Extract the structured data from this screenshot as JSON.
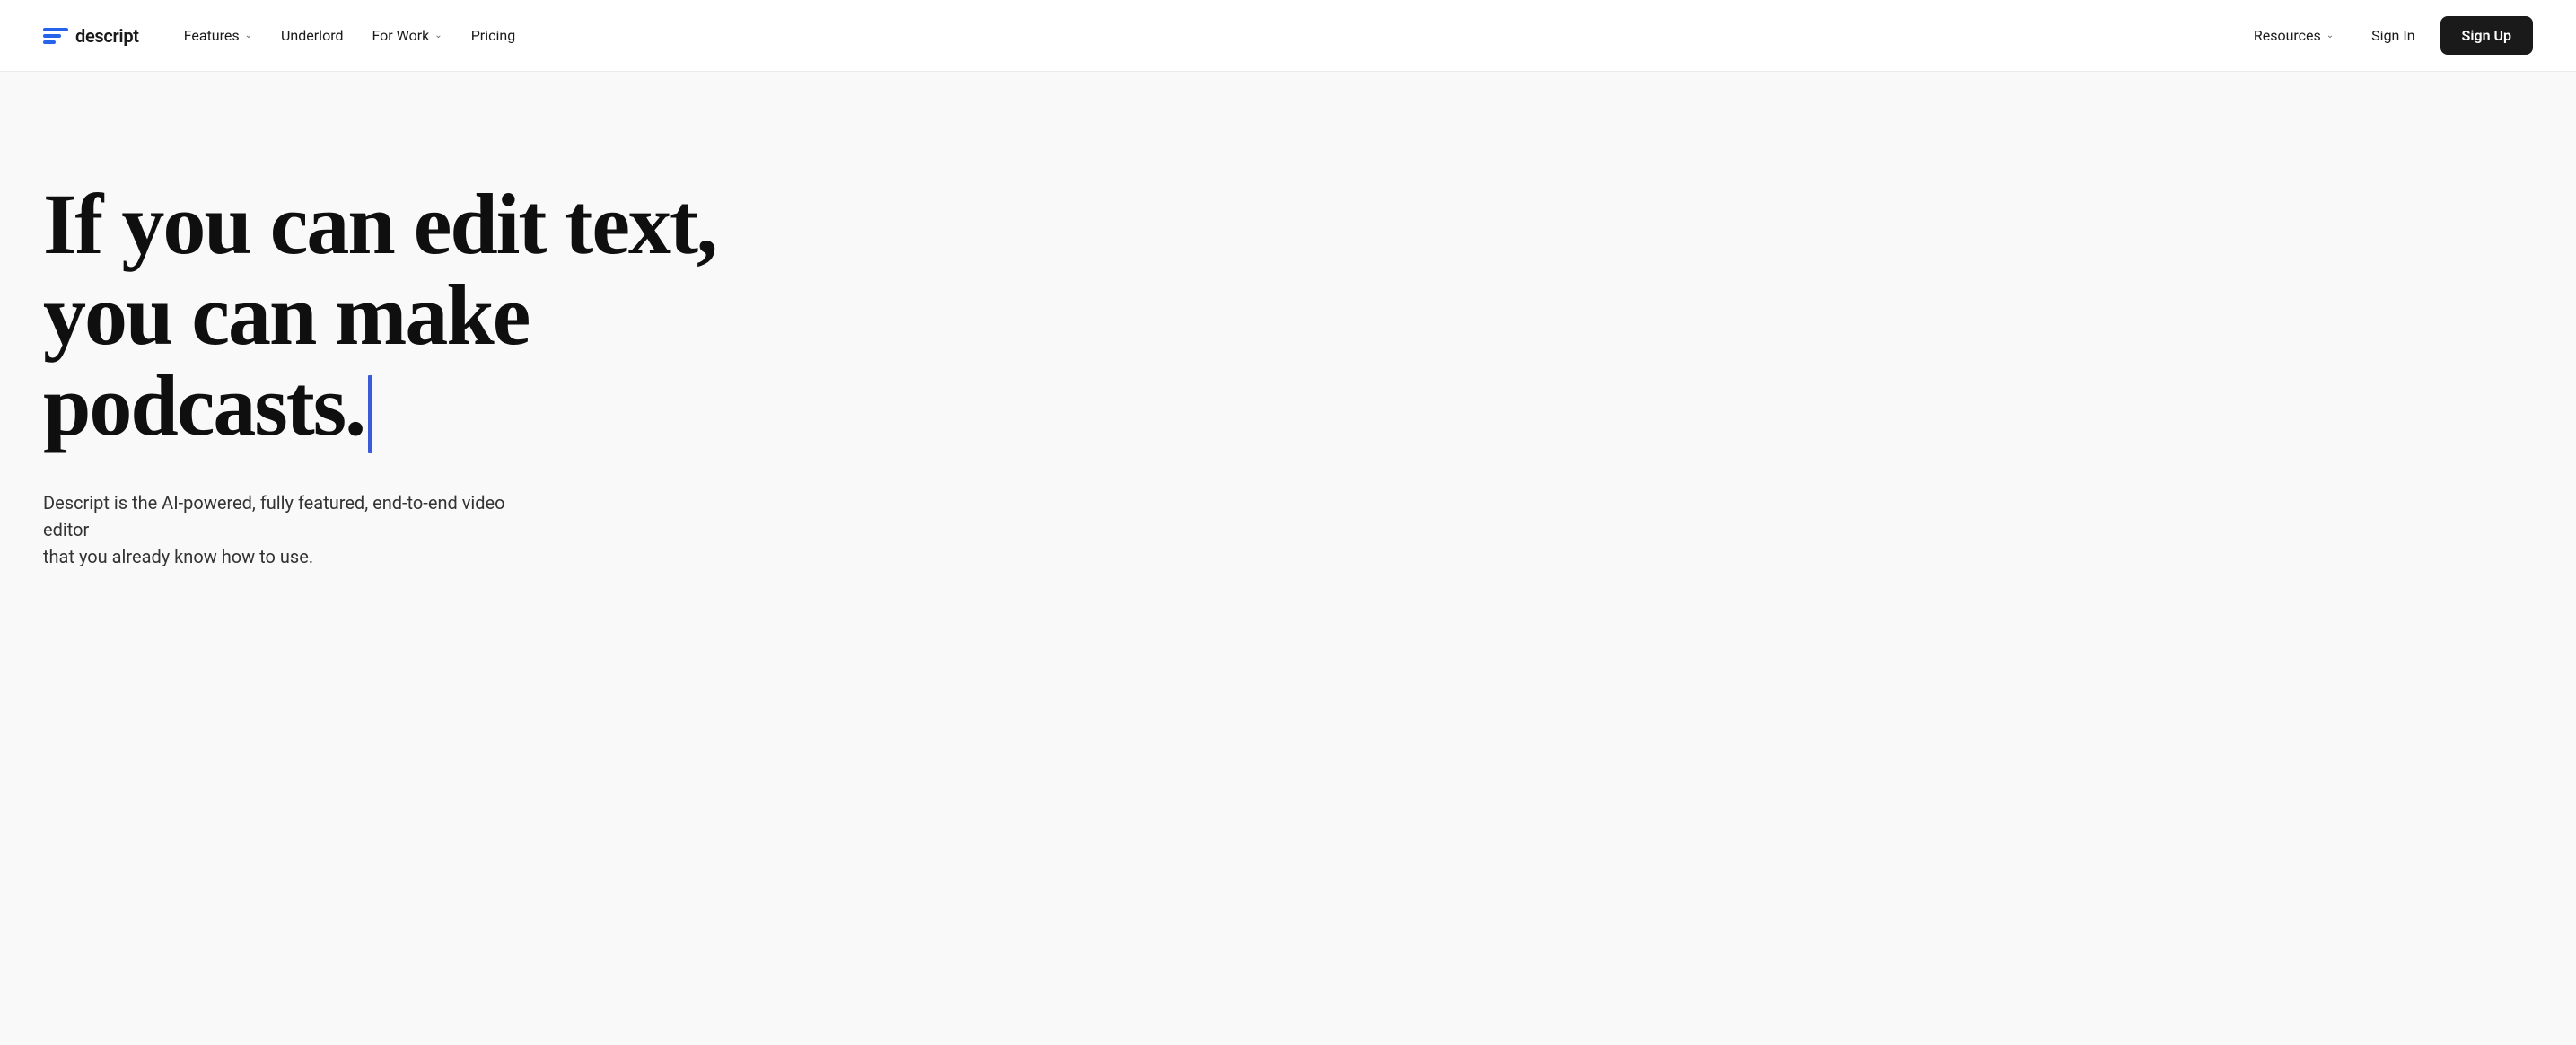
{
  "nav": {
    "logo": {
      "text": "descript"
    },
    "links": [
      {
        "label": "Features",
        "hasDropdown": true
      },
      {
        "label": "Underlord",
        "hasDropdown": false
      },
      {
        "label": "For Work",
        "hasDropdown": true
      },
      {
        "label": "Pricing",
        "hasDropdown": false
      }
    ],
    "right_links": [
      {
        "label": "Resources",
        "hasDropdown": true
      }
    ],
    "sign_in_label": "Sign In",
    "sign_up_label": "Sign Up"
  },
  "hero": {
    "headline_line1": "If you can edit text,",
    "headline_line2": "you can make podcasts.",
    "subtitle_line1": "Descript is the AI-powered, fully featured, end-to-end video editor",
    "subtitle_line2": "that you already know how to use."
  },
  "colors": {
    "cursor": "#3b5bdb",
    "logo_blue": "#2563eb",
    "nav_bg": "#ffffff",
    "hero_bg": "#f9f9f9",
    "cta_bg": "#1a1a1a",
    "cta_text": "#ffffff"
  }
}
